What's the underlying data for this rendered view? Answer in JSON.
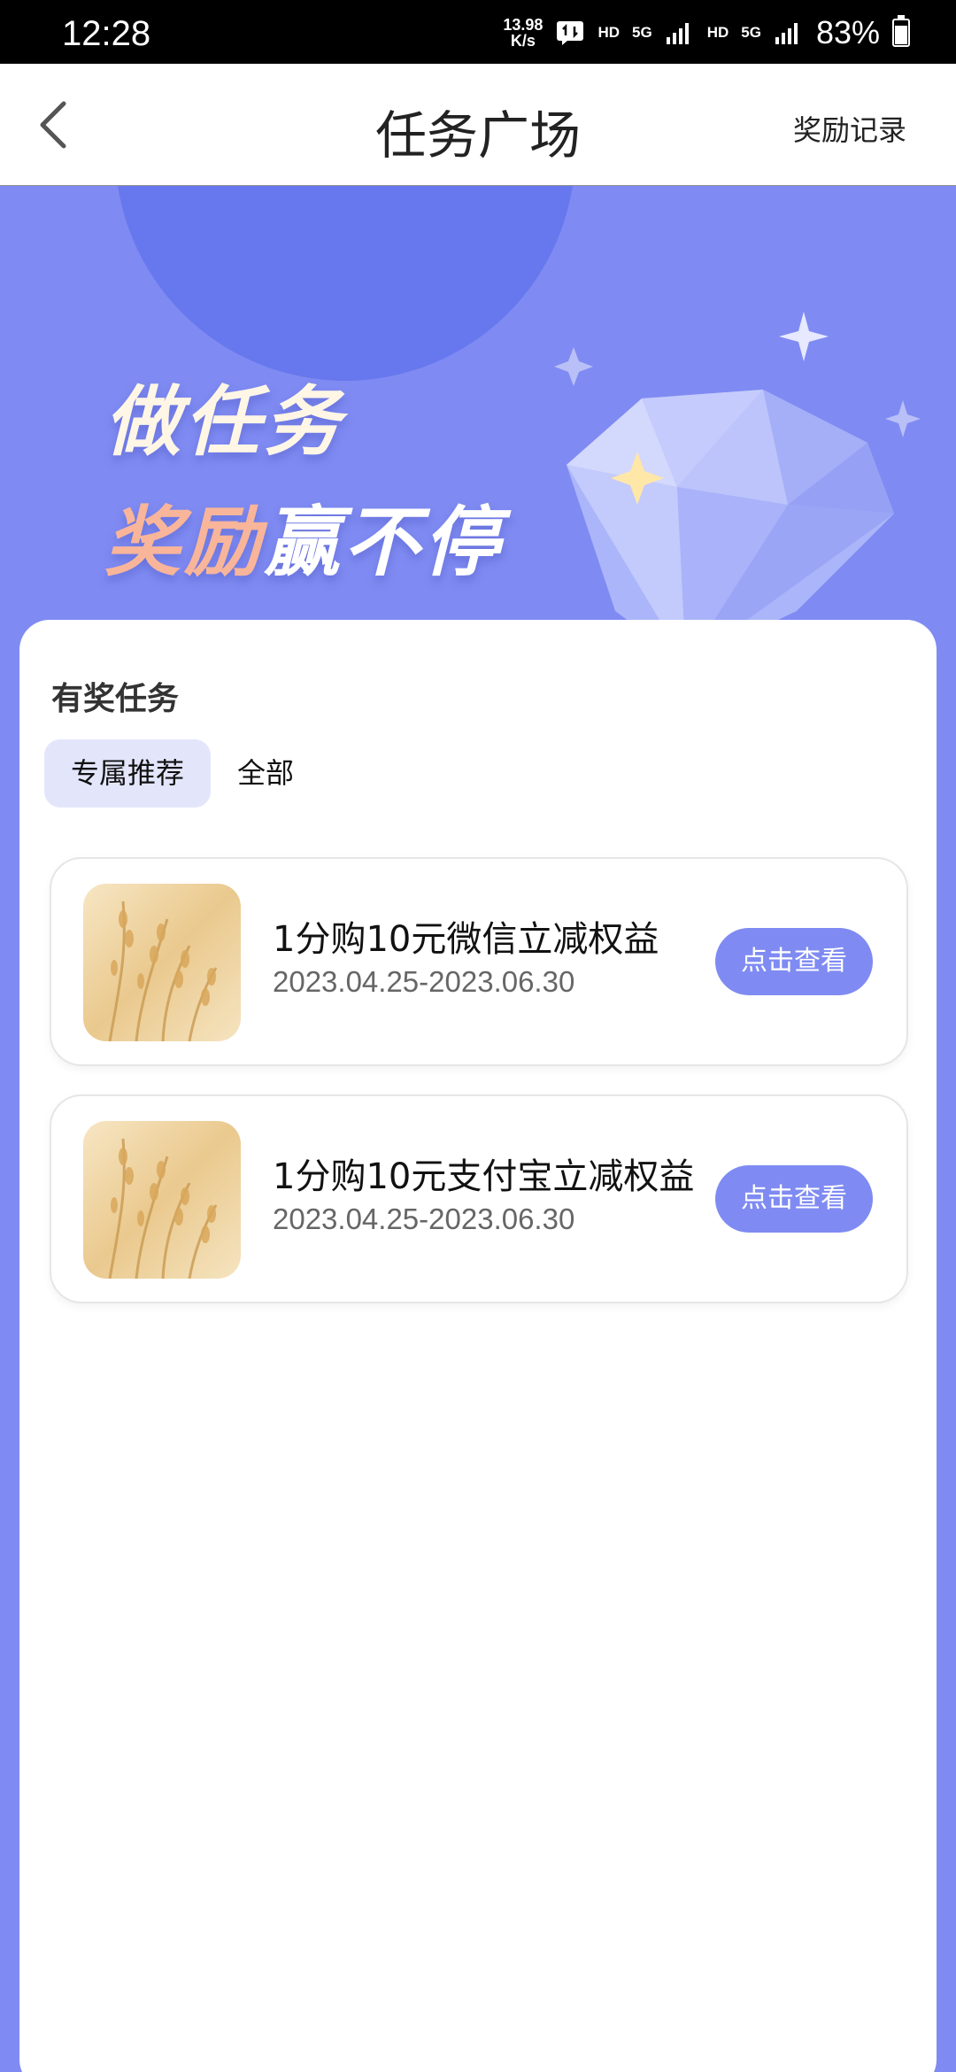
{
  "status_bar": {
    "time": "12:28",
    "net_speed_value": "13.98",
    "net_speed_unit": "K/s",
    "hd1": "HD",
    "net1": "5G",
    "hd2": "HD",
    "net2": "5G",
    "battery": "83%"
  },
  "header": {
    "title": "任务广场",
    "right_link": "奖励记录"
  },
  "banner": {
    "line1": "做任务",
    "line2_accent": "奖励",
    "line2_rest": "赢不停"
  },
  "section": {
    "title": "有奖任务",
    "tabs": [
      {
        "label": "专属推荐",
        "active": true
      },
      {
        "label": "全部",
        "active": false
      }
    ]
  },
  "tasks": [
    {
      "title": "1分购10元微信立减权益",
      "date": "2023.04.25-2023.06.30",
      "button": "点击查看"
    },
    {
      "title": "1分购10元支付宝立减权益",
      "date": "2023.04.25-2023.06.30",
      "button": "点击查看"
    }
  ],
  "colors": {
    "accent": "#7f8bf2",
    "tab_active_bg": "#e3e6fb",
    "banner_highlight": "#f8b59a"
  },
  "icons": {
    "back": "back-arrow-icon",
    "diamond": "diamond-illustration",
    "battery": "battery-icon"
  }
}
